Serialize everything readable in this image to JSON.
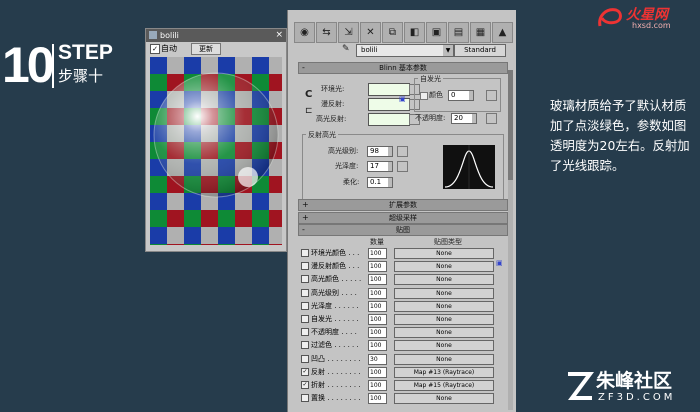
{
  "step": {
    "number": "10",
    "word": "STEP",
    "cn": "步骤十"
  },
  "preview": {
    "title": "bolili",
    "auto_label": "自动",
    "update_button": "更新"
  },
  "editor": {
    "material_name": "bolili",
    "type_button": "Standard",
    "blinn": {
      "header": "Blinn 基本参数",
      "ambient": "环境光:",
      "diffuse": "漫反射:",
      "specular": "高光反射:",
      "self_illum_group": "自发光",
      "color_label": "颜色",
      "color_value": "0",
      "opacity_label": "不透明度:",
      "opacity_value": "20",
      "spec_group": "反射高光",
      "spec_level_label": "高光级别:",
      "spec_level_value": "98",
      "gloss_label": "光泽度:",
      "gloss_value": "17",
      "soften_label": "柔化:",
      "soften_value": "0.1"
    },
    "rollouts": {
      "extended": "扩展参数",
      "supersampling": "超级采样",
      "maps": "贴图"
    },
    "maps_headers": {
      "amount": "数量",
      "map_type": "贴图类型"
    },
    "maps": [
      {
        "name": "环境光颜色 . . .",
        "amount": "100",
        "map": "None",
        "checked": ""
      },
      {
        "name": "漫反射颜色 . . .",
        "amount": "100",
        "map": "None",
        "checked": ""
      },
      {
        "name": "高光颜色 . . . . .",
        "amount": "100",
        "map": "None",
        "checked": ""
      },
      {
        "name": "高光级别 . . . .",
        "amount": "100",
        "map": "None",
        "checked": ""
      },
      {
        "name": "光泽度 . . . . . .",
        "amount": "100",
        "map": "None",
        "checked": ""
      },
      {
        "name": "自发光 . . . . . .",
        "amount": "100",
        "map": "None",
        "checked": ""
      },
      {
        "name": "不透明度 . . . .",
        "amount": "100",
        "map": "None",
        "checked": ""
      },
      {
        "name": "过滤色 . . . . . .",
        "amount": "100",
        "map": "None",
        "checked": ""
      },
      {
        "name": "凹凸 . . . . . . . .",
        "amount": "30",
        "map": "None",
        "checked": ""
      },
      {
        "name": "反射 . . . . . . . .",
        "amount": "100",
        "map": "Map #13 (Raytrace)",
        "checked": "✓"
      },
      {
        "name": "折射 . . . . . . . .",
        "amount": "100",
        "map": "Map #15 (Raytrace)",
        "checked": "✓"
      },
      {
        "name": "置换 . . . . . . . .",
        "amount": "100",
        "map": "None",
        "checked": ""
      }
    ]
  },
  "description": [
    "玻璃材质给予了默认材质",
    "加了点淡绿色，参数如图",
    "透明度为20左右。反射加",
    "了光线跟踪。"
  ],
  "logo_top": {
    "brand": "火星网",
    "url": "hxsd.com"
  },
  "logo_bottom": {
    "cn": "朱峰社区",
    "en": "ZF3D.COM"
  }
}
